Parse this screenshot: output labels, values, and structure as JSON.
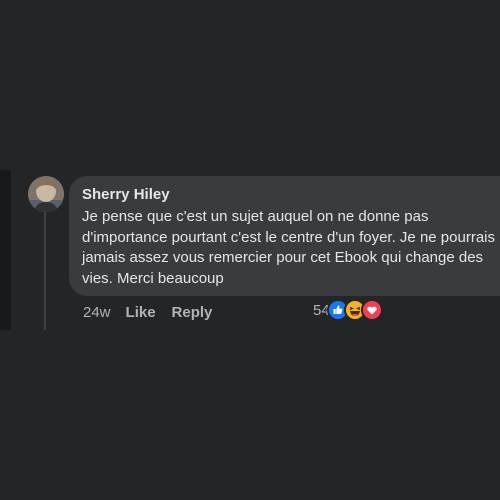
{
  "comment": {
    "author": "Sherry Hiley",
    "text": "Je pense que c'est un sujet auquel on ne donne pas d'importance pourtant c'est le centre d'un foyer. Je ne pourrais jamais assez vous remercier pour cet Ebook qui change des vies. Merci beaucoup",
    "time": "24w",
    "like_label": "Like",
    "reply_label": "Reply",
    "reaction_count": "54",
    "reaction_icons": [
      "like-icon",
      "haha-icon",
      "love-icon"
    ]
  },
  "colors": {
    "background": "#242526",
    "bubble": "#3a3b3c",
    "text": "#e4e6eb",
    "secondary_text": "#b0b3b8",
    "like_blue": "#1877f2",
    "haha_yellow": "#f7b125",
    "love_red": "#f33e58"
  }
}
